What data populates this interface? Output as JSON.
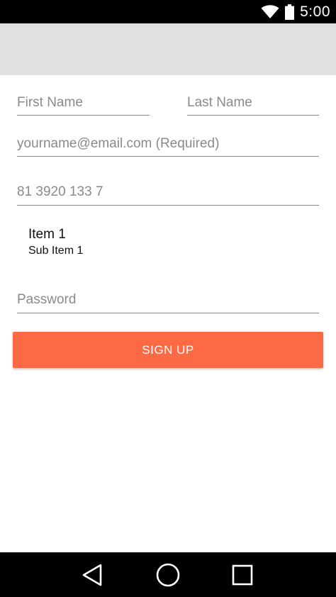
{
  "status_bar": {
    "time": "5:00",
    "icons": [
      "wifi-icon",
      "battery-icon"
    ]
  },
  "form": {
    "first_name": {
      "placeholder": "First Name",
      "value": ""
    },
    "last_name": {
      "placeholder": "Last Name",
      "value": ""
    },
    "email": {
      "placeholder": "yourname@email.com (Required)",
      "value": ""
    },
    "phone": {
      "placeholder": "81 3920 133 7",
      "value": ""
    },
    "list_item": {
      "title": "Item 1",
      "subtitle": "Sub Item 1"
    },
    "password": {
      "placeholder": "Password",
      "value": ""
    },
    "signup_label": "SIGN UP"
  },
  "colors": {
    "accent": "#fb6a45",
    "app_bar": "#e0e0e0",
    "system_bars": "#000000"
  },
  "nav_bar": {
    "icons": [
      "back-icon",
      "home-icon",
      "recents-icon"
    ]
  }
}
